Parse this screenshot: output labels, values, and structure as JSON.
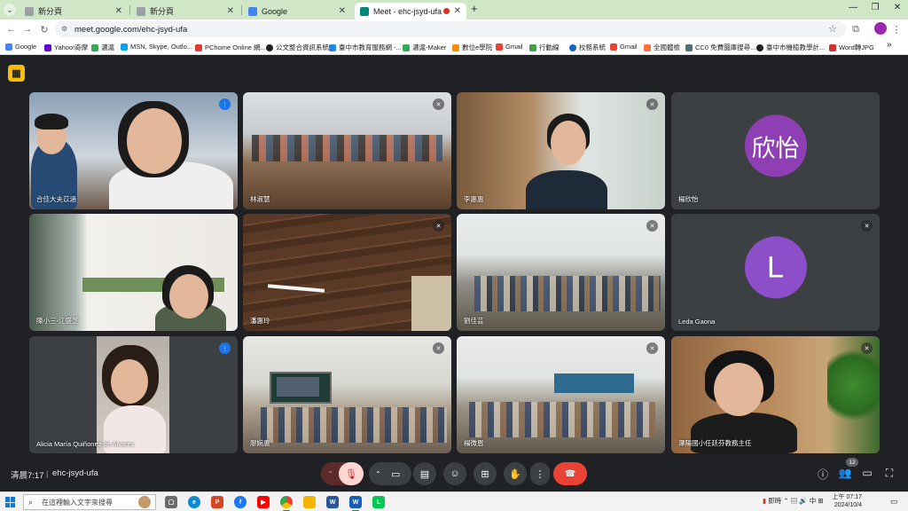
{
  "browser": {
    "tabs": [
      {
        "title": "新分頁",
        "active": false
      },
      {
        "title": "新分頁",
        "active": false
      },
      {
        "title": "Google",
        "active": false
      },
      {
        "title": "Meet - ehc-jsyd-ufa",
        "active": true
      }
    ],
    "url": "meet.google.com/ehc-jsyd-ufa",
    "bookmarks": [
      "Google",
      "Yahoo!奇摩",
      "濃滬",
      "MSN, Skype, Outlo...",
      "PChome Online 網...",
      "公文整合資訊系統",
      "臺中市教育服務網 -...",
      "濃滬-Maker",
      "數位e學院",
      "Gmail",
      "行動線",
      "校務系統",
      "Gmail",
      "全國體檢",
      "CC0 免費圖庫搜尋...",
      "臺中市機植教學計...",
      "Word轉JPG"
    ]
  },
  "meet": {
    "participants": [
      {
        "name": "合佳大夫苡涵",
        "tile_type": "video",
        "mic": "active",
        "speaking": true
      },
      {
        "name": "林淑慧",
        "tile_type": "video",
        "mic": "muted"
      },
      {
        "name": "李惠惠",
        "tile_type": "video",
        "mic": "muted"
      },
      {
        "name": "楊欣怡",
        "tile_type": "avatar",
        "avatar_text": "欣怡",
        "avatar_color": "#8e3fb4",
        "mic": "none"
      },
      {
        "name": "陳小三-江盛芝",
        "tile_type": "video",
        "mic": "none"
      },
      {
        "name": "潘惠玲",
        "tile_type": "video",
        "mic": "muted"
      },
      {
        "name": "劉佳芸",
        "tile_type": "video",
        "mic": "muted"
      },
      {
        "name": "Leda Gaona",
        "tile_type": "avatar",
        "avatar_text": "L",
        "avatar_color": "#8d4ec9",
        "mic": "muted"
      },
      {
        "name": "Alicia María Quiñonez de Alvarez",
        "tile_type": "video",
        "mic": "active"
      },
      {
        "name": "廖婉惠",
        "tile_type": "video",
        "mic": "muted"
      },
      {
        "name": "楊微恩",
        "tile_type": "video",
        "mic": "muted"
      },
      {
        "name": "潭陽國小任廷芬教務主任",
        "tile_type": "video",
        "mic": "muted"
      }
    ],
    "meeting_time": "清晨7:17",
    "meeting_code": "ehc-jsyd-ufa",
    "people_count": "12"
  },
  "taskbar": {
    "search_placeholder": "在這裡輸入文字來搜尋",
    "tray_weather": "即時",
    "tray_ime": "中",
    "time": "上午 07:17",
    "date": "2024/10/4"
  },
  "colors": {
    "meet_bg": "#202124",
    "tile_bg": "#3c4043",
    "hangup": "#ea4335",
    "speaking_outline": "#8ab4f8",
    "chrome_tabstrip": "#cfe6c7"
  }
}
